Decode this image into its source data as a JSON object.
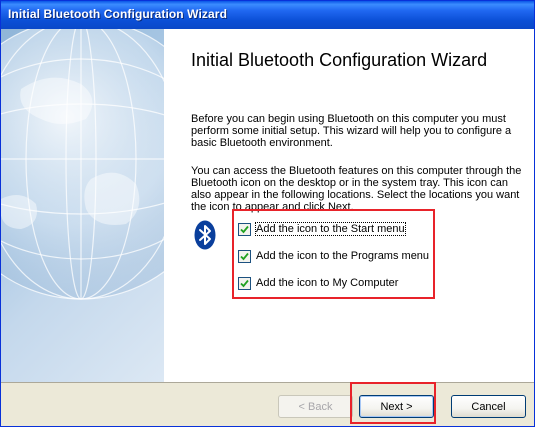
{
  "window": {
    "title": "Initial Bluetooth Configuration Wizard"
  },
  "wizard": {
    "heading": "Initial Bluetooth Configuration Wizard",
    "paragraph1": "Before you can begin using Bluetooth on this computer you must perform some initial setup. This wizard will help you to configure a basic Bluetooth environment.",
    "paragraph2": "You can access the Bluetooth features on this computer through the Bluetooth icon on the desktop or in the system tray. This icon can also appear in the following locations. Select the locations you want the icon to appear and click Next.",
    "bluetooth_icon": "bluetooth-icon",
    "options": [
      {
        "label": "Add the icon to the Start menu",
        "checked": true
      },
      {
        "label": "Add the icon to the Programs menu",
        "checked": true
      },
      {
        "label": "Add the icon to My Computer",
        "checked": true
      }
    ]
  },
  "footer": {
    "back_label": "< Back",
    "back_accel": "B",
    "next_label": "Next >",
    "next_accel": "N",
    "cancel_label": "Cancel"
  },
  "colors": {
    "title_bar": "#0a56e6",
    "highlight": "#e8232a",
    "bluetooth_blue": "#0a3f9c"
  }
}
